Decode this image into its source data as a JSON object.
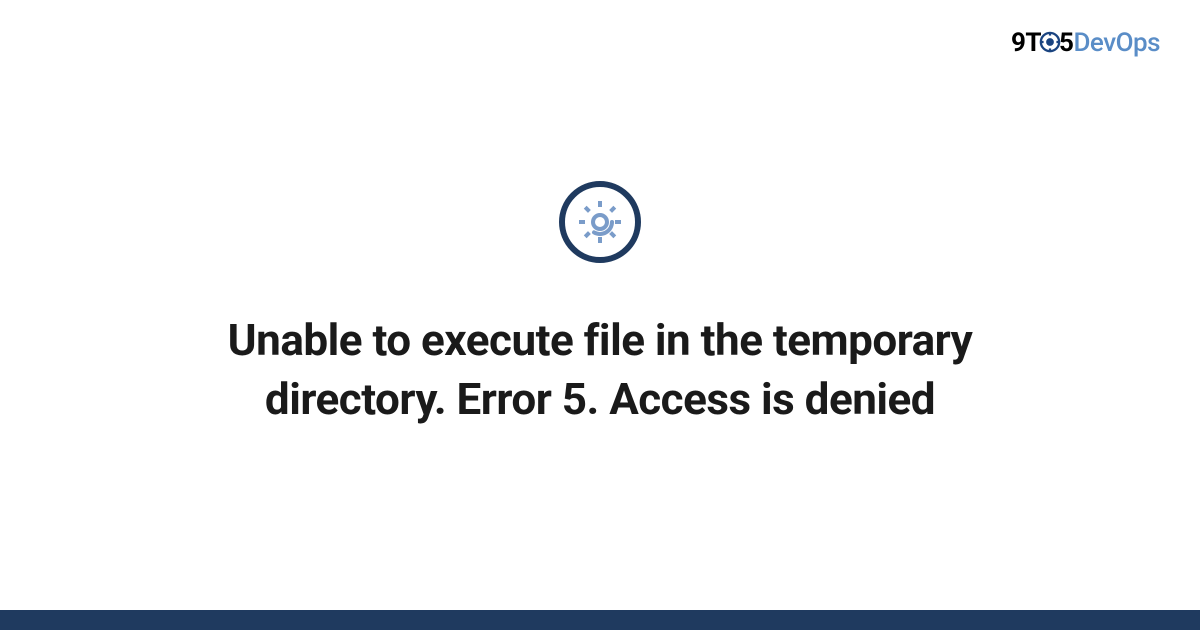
{
  "logo": {
    "part1": "9T",
    "part2": "5",
    "part3": "DevOps"
  },
  "icon": {
    "name": "gear-icon"
  },
  "title": "Unable to execute file in the temporary directory. Error 5. Access is denied",
  "colors": {
    "brand_dark": "#1f3a5f",
    "brand_light": "#5a8dc7",
    "icon_stroke": "#7a9cc9"
  }
}
